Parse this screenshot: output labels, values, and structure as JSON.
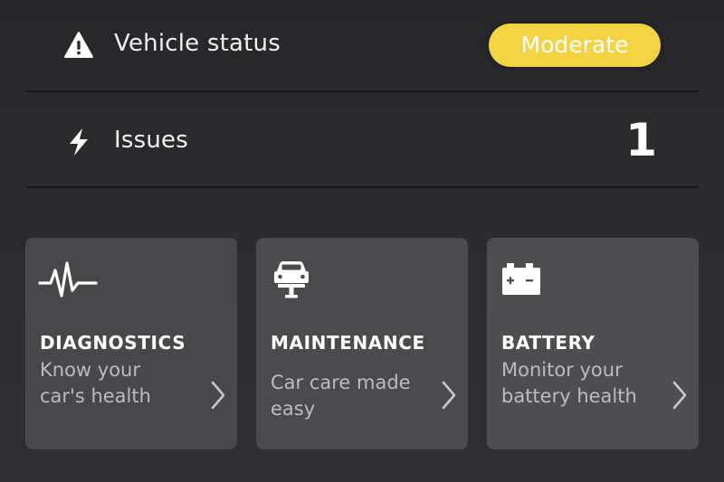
{
  "status_row": {
    "label": "Vehicle status",
    "icon": "warning-icon",
    "badge": "Moderate",
    "badge_color": "#f3d341"
  },
  "issues_row": {
    "label": "Issues",
    "icon": "lightning-icon",
    "count": "1"
  },
  "cards": [
    {
      "title": "DIAGNOSTICS",
      "description": "Know your car's health",
      "icon": "heartbeat-icon"
    },
    {
      "title": "MAINTENANCE",
      "description": "Car care made easy",
      "icon": "car-lift-icon"
    },
    {
      "title": "BATTERY",
      "description": "Monitor your battery health",
      "icon": "battery-icon"
    }
  ],
  "colors": {
    "background": "#2a2c30",
    "card": "#4a4b4f",
    "divider": "#15161a",
    "secondary_text": "#bcbcbf"
  }
}
